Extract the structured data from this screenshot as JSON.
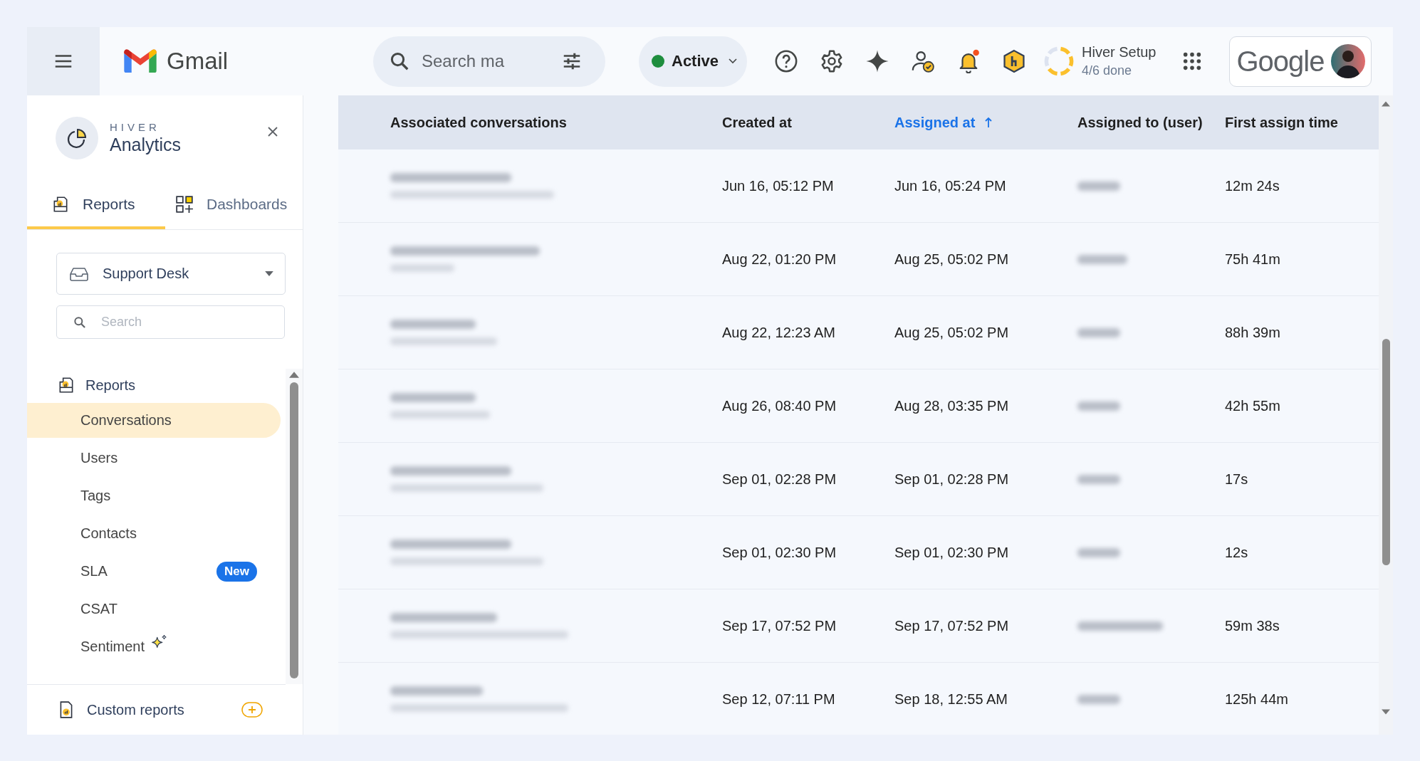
{
  "topbar": {
    "app_name": "Gmail",
    "search": {
      "placeholder": "Search ma"
    },
    "status": {
      "label": "Active",
      "color": "#1e8e3e"
    },
    "notification_dot": true,
    "setup": {
      "title": "Hiver Setup",
      "progress": "4/6 done",
      "level": 0.67
    },
    "account_logo": "Google"
  },
  "sidebar": {
    "brand": "HIVER",
    "title": "Analytics",
    "tabs": [
      {
        "label": "Reports",
        "selected": true
      },
      {
        "label": "Dashboards",
        "selected": false
      }
    ],
    "inbox": {
      "value": "Support Desk"
    },
    "search": {
      "placeholder": "Search"
    },
    "section": "Reports",
    "items": [
      {
        "label": "Conversations",
        "selected": true
      },
      {
        "label": "Users",
        "selected": false
      },
      {
        "label": "Tags",
        "selected": false
      },
      {
        "label": "Contacts",
        "selected": false
      },
      {
        "label": "SLA",
        "selected": false,
        "badge": "New"
      },
      {
        "label": "CSAT",
        "selected": false
      },
      {
        "label": "Sentiment",
        "selected": false,
        "sparkle": true
      }
    ],
    "custom_reports": "Custom reports"
  },
  "table": {
    "columns": [
      {
        "label": "Associated conversations",
        "sorted": false
      },
      {
        "label": "Created at",
        "sorted": false
      },
      {
        "label": "Assigned at",
        "sorted": true
      },
      {
        "label": "Assigned to (user)",
        "sorted": false
      },
      {
        "label": "First assign time",
        "sorted": false
      }
    ],
    "rows": [
      {
        "redacted": true,
        "created_at": "Jun 16, 05:12 PM",
        "assigned_at": "Jun 16, 05:24 PM",
        "first_assign_time": "12m 24s"
      },
      {
        "redacted": true,
        "created_at": "Aug 22, 01:20 PM",
        "assigned_at": "Aug 25, 05:02 PM",
        "first_assign_time": "75h 41m"
      },
      {
        "redacted": true,
        "created_at": "Aug 22, 12:23 AM",
        "assigned_at": "Aug 25, 05:02 PM",
        "first_assign_time": "88h 39m"
      },
      {
        "redacted": true,
        "created_at": "Aug 26, 08:40 PM",
        "assigned_at": "Aug 28, 03:35 PM",
        "first_assign_time": "42h 55m"
      },
      {
        "redacted": true,
        "created_at": "Sep 01, 02:28 PM",
        "assigned_at": "Sep 01, 02:28 PM",
        "first_assign_time": "17s"
      },
      {
        "redacted": true,
        "created_at": "Sep 01, 02:30 PM",
        "assigned_at": "Sep 01, 02:30 PM",
        "first_assign_time": "12s"
      },
      {
        "redacted": true,
        "created_at": "Sep 17, 07:52 PM",
        "assigned_at": "Sep 17, 07:52 PM",
        "first_assign_time": "59m 38s"
      },
      {
        "redacted": true,
        "created_at": "Sep 12, 07:11 PM",
        "assigned_at": "Sep 18, 12:55 AM",
        "first_assign_time": "125h 44m"
      }
    ]
  }
}
